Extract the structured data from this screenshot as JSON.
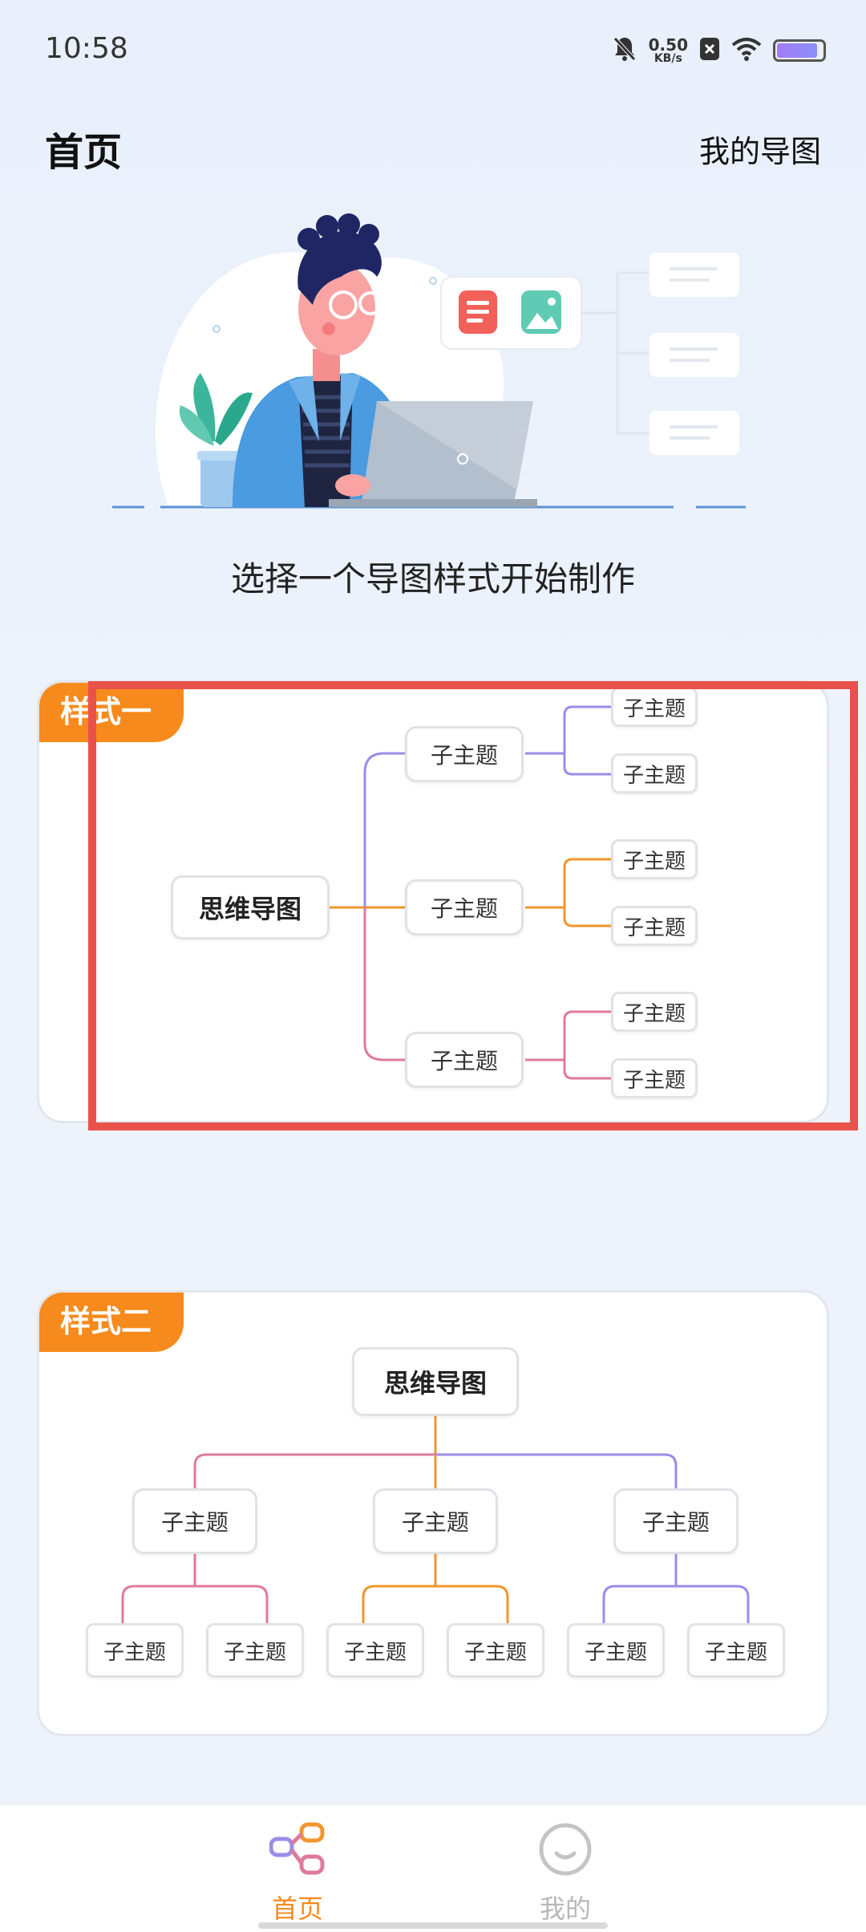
{
  "status_bar": {
    "time": "10:58",
    "net_speed_value": "0.50",
    "net_speed_unit": "KB/s",
    "icons": [
      "bell-mute-icon",
      "close-badge-icon",
      "wifi-icon",
      "battery-icon"
    ]
  },
  "header": {
    "title": "首页",
    "my_maps_link": "我的导图"
  },
  "hero": {
    "illustration": "person-with-laptop-illustration",
    "tagline": "选择一个导图样式开始制作"
  },
  "templates": [
    {
      "tag": "样式一",
      "root": "思维导图",
      "branches": [
        {
          "label": "子主题",
          "children": [
            "子主题",
            "子主题"
          ],
          "color": "#9b8ce8"
        },
        {
          "label": "子主题",
          "children": [
            "子主题",
            "子主题"
          ],
          "color": "#f0962e"
        },
        {
          "label": "子主题",
          "children": [
            "子主题",
            "子主题"
          ],
          "color": "#e07a9d"
        }
      ]
    },
    {
      "tag": "样式二",
      "root": "思维导图",
      "branches": [
        {
          "label": "子主题",
          "children": [
            "子主题",
            "子主题"
          ],
          "color": "#e07a9d"
        },
        {
          "label": "子主题",
          "children": [
            "子主题",
            "子主题"
          ],
          "color": "#f0962e"
        },
        {
          "label": "子主题",
          "children": [
            "子主题",
            "子主题"
          ],
          "color": "#9b8ce8"
        }
      ]
    }
  ],
  "bottom_nav": {
    "items": [
      {
        "label": "首页",
        "icon": "mindmap-icon",
        "active": true
      },
      {
        "label": "我的",
        "icon": "smiley-icon",
        "active": false
      }
    ]
  },
  "colors": {
    "accent": "#f78a1c",
    "highlight": "#e9514b"
  }
}
